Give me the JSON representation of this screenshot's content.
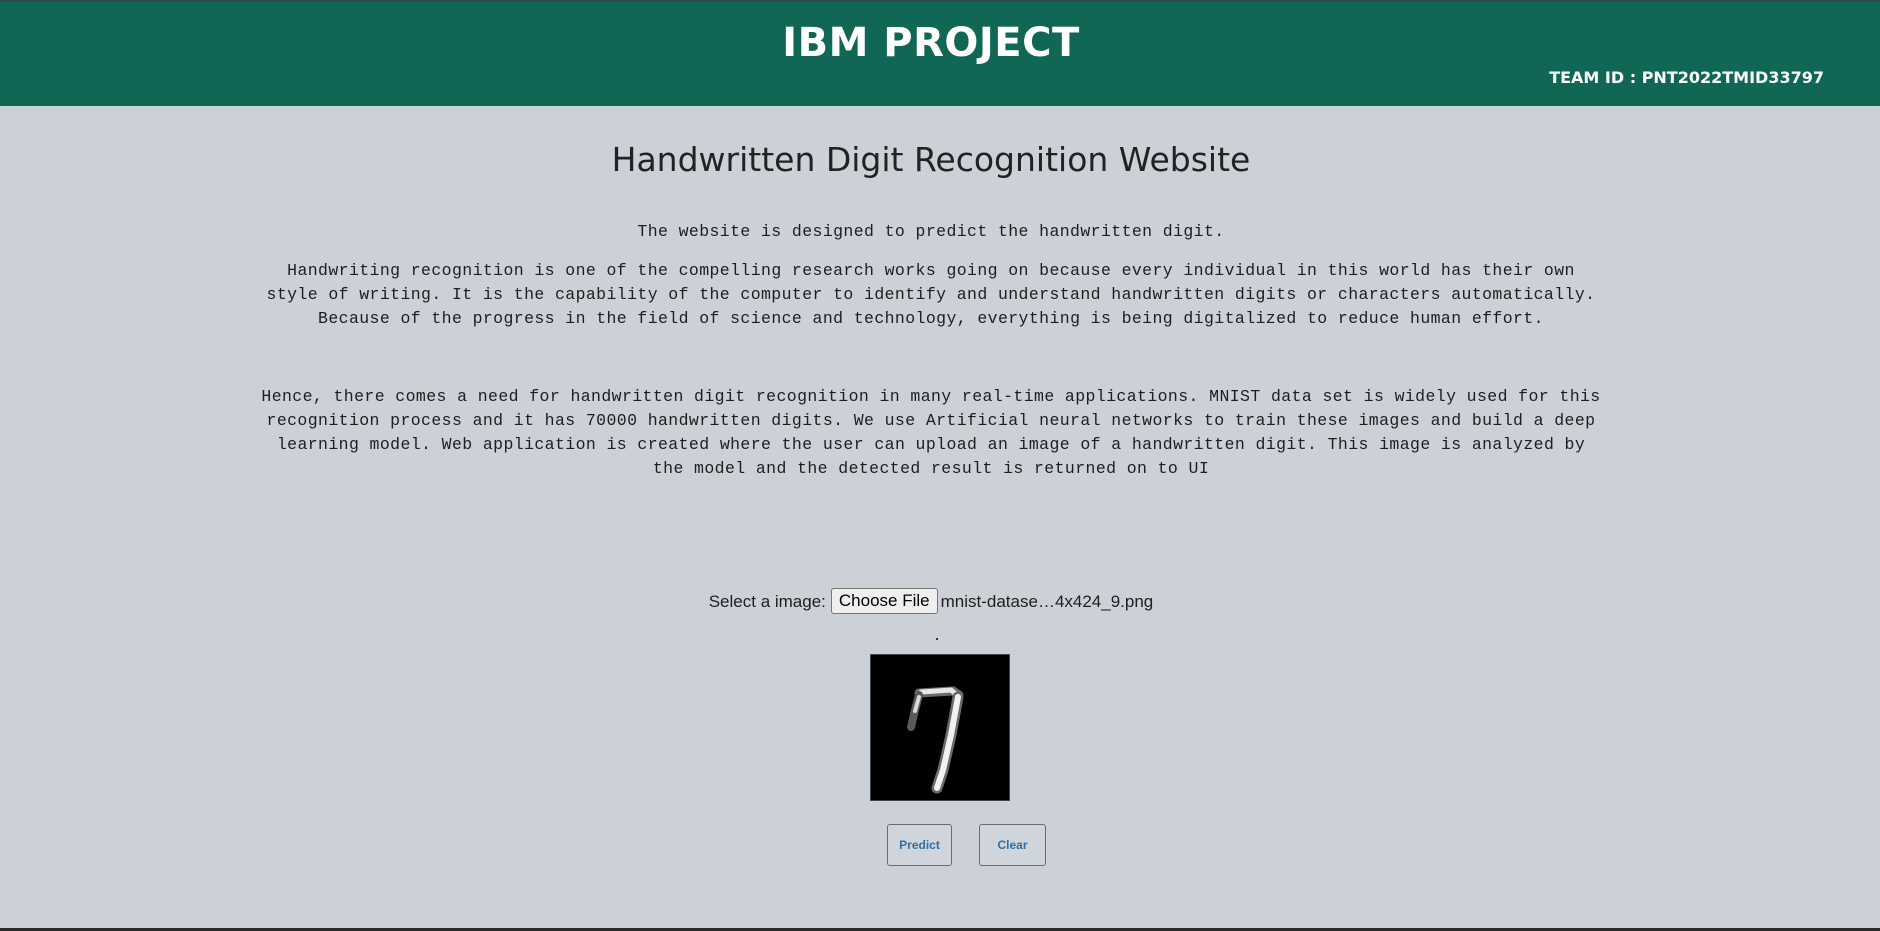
{
  "header": {
    "title": "IBM PROJECT",
    "team_id": "TEAM ID : PNT2022TMID33797",
    "background_color": "#106755"
  },
  "main": {
    "title": "Handwritten Digit Recognition Website",
    "intro": "The website is designed to predict the handwritten digit.",
    "paragraph_1": "Handwriting recognition is one of the compelling research works going on because every individual in this world has their own style of writing. It is the capability of the computer to identify and understand handwritten digits or characters automatically. Because of the progress in the field of science and technology, everything is being digitalized to reduce human effort.",
    "paragraph_2": "Hence, there comes a need for handwritten digit recognition in many real-time applications. MNIST data set is widely used for this recognition process and it has 70000 handwritten digits. We use Artificial neural networks to train these images and build a deep learning model. Web application is created where the user can upload an image of a handwritten digit. This image is analyzed by the model and the detected result is returned on to UI"
  },
  "upload": {
    "label": "Select a image:",
    "button_label": "Choose File",
    "filename": "mnist-datase…4x424_9.png"
  },
  "preview": {
    "icon": "handwritten-digit-image"
  },
  "actions": {
    "predict_label": "Predict",
    "clear_label": "Clear"
  }
}
